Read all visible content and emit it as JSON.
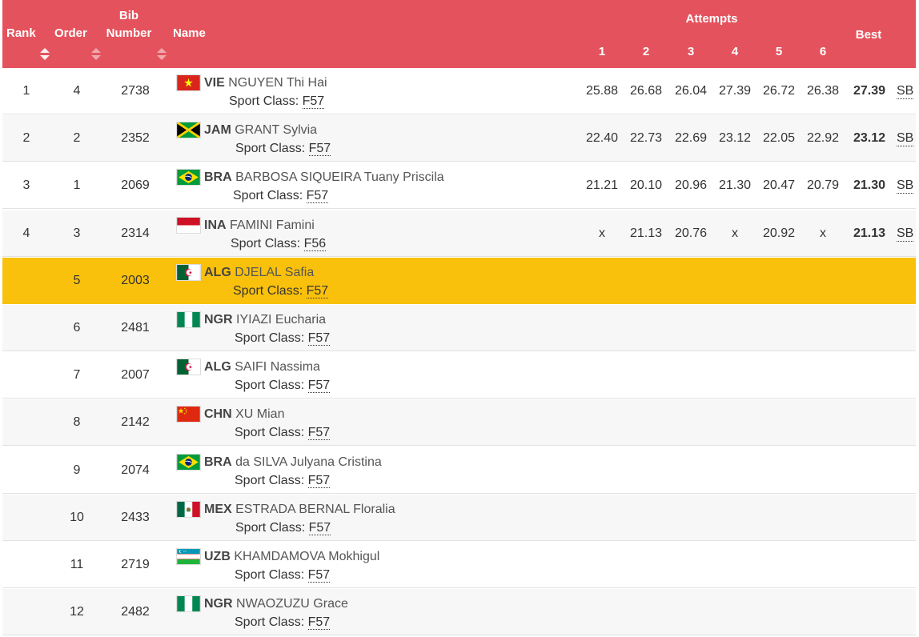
{
  "header": {
    "rank": "Rank",
    "order": "Order",
    "bib_line1": "Bib",
    "bib_line2": "Number",
    "name": "Name",
    "attempts": "Attempts",
    "attempt_numbers": [
      "1",
      "2",
      "3",
      "4",
      "5",
      "6"
    ],
    "best": "Best"
  },
  "colors": {
    "header_bg": "#e4535d",
    "highlight_row": "#f9c10b"
  },
  "sport_class_label": "Sport Class: ",
  "rows": [
    {
      "rank": "1",
      "order": "4",
      "bib": "2738",
      "flag": "vietnam-flag",
      "country": "VIE",
      "name": "NGUYEN Thi Hai",
      "sport_class": "F57",
      "attempts": [
        "25.88",
        "26.68",
        "26.04",
        "27.39",
        "26.72",
        "26.38"
      ],
      "best": "27.39",
      "record": "SB"
    },
    {
      "rank": "2",
      "order": "2",
      "bib": "2352",
      "flag": "jamaica-flag",
      "country": "JAM",
      "name": "GRANT Sylvia",
      "sport_class": "F57",
      "attempts": [
        "22.40",
        "22.73",
        "22.69",
        "23.12",
        "22.05",
        "22.92"
      ],
      "best": "23.12",
      "record": "SB"
    },
    {
      "rank": "3",
      "order": "1",
      "bib": "2069",
      "flag": "brazil-flag",
      "country": "BRA",
      "name": "BARBOSA SIQUEIRA Tuany Priscila",
      "sport_class": "F57",
      "attempts": [
        "21.21",
        "20.10",
        "20.96",
        "21.30",
        "20.47",
        "20.79"
      ],
      "best": "21.30",
      "record": "SB"
    },
    {
      "rank": "4",
      "order": "3",
      "bib": "2314",
      "flag": "indonesia-flag",
      "country": "INA",
      "name": "FAMINI Famini",
      "sport_class": "F56",
      "attempts": [
        "x",
        "21.13",
        "20.76",
        "x",
        "20.92",
        "x"
      ],
      "best": "21.13",
      "record": "SB"
    },
    {
      "rank": "",
      "order": "5",
      "bib": "2003",
      "flag": "algeria-flag",
      "country": "ALG",
      "name": "DJELAL Safia",
      "sport_class": "F57",
      "attempts": [
        "",
        "",
        "",
        "",
        "",
        ""
      ],
      "best": "",
      "record": ""
    },
    {
      "rank": "",
      "order": "6",
      "bib": "2481",
      "flag": "nigeria-flag",
      "country": "NGR",
      "name": "IYIAZI Eucharia",
      "sport_class": "F57",
      "attempts": [
        "",
        "",
        "",
        "",
        "",
        ""
      ],
      "best": "",
      "record": ""
    },
    {
      "rank": "",
      "order": "7",
      "bib": "2007",
      "flag": "algeria-flag",
      "country": "ALG",
      "name": "SAIFI Nassima",
      "sport_class": "F57",
      "attempts": [
        "",
        "",
        "",
        "",
        "",
        ""
      ],
      "best": "",
      "record": ""
    },
    {
      "rank": "",
      "order": "8",
      "bib": "2142",
      "flag": "china-flag",
      "country": "CHN",
      "name": "XU Mian",
      "sport_class": "F57",
      "attempts": [
        "",
        "",
        "",
        "",
        "",
        ""
      ],
      "best": "",
      "record": ""
    },
    {
      "rank": "",
      "order": "9",
      "bib": "2074",
      "flag": "brazil-flag",
      "country": "BRA",
      "name": "da SILVA Julyana Cristina",
      "sport_class": "F57",
      "attempts": [
        "",
        "",
        "",
        "",
        "",
        ""
      ],
      "best": "",
      "record": ""
    },
    {
      "rank": "",
      "order": "10",
      "bib": "2433",
      "flag": "mexico-flag",
      "country": "MEX",
      "name": "ESTRADA BERNAL Floralia",
      "sport_class": "F57",
      "attempts": [
        "",
        "",
        "",
        "",
        "",
        ""
      ],
      "best": "",
      "record": ""
    },
    {
      "rank": "",
      "order": "11",
      "bib": "2719",
      "flag": "uzbekistan-flag",
      "country": "UZB",
      "name": "KHAMDAMOVA Mokhigul",
      "sport_class": "F57",
      "attempts": [
        "",
        "",
        "",
        "",
        "",
        ""
      ],
      "best": "",
      "record": ""
    },
    {
      "rank": "",
      "order": "12",
      "bib": "2482",
      "flag": "nigeria-flag",
      "country": "NGR",
      "name": "NWAOZUZU Grace",
      "sport_class": "F57",
      "attempts": [
        "",
        "",
        "",
        "",
        "",
        ""
      ],
      "best": "",
      "record": ""
    }
  ]
}
